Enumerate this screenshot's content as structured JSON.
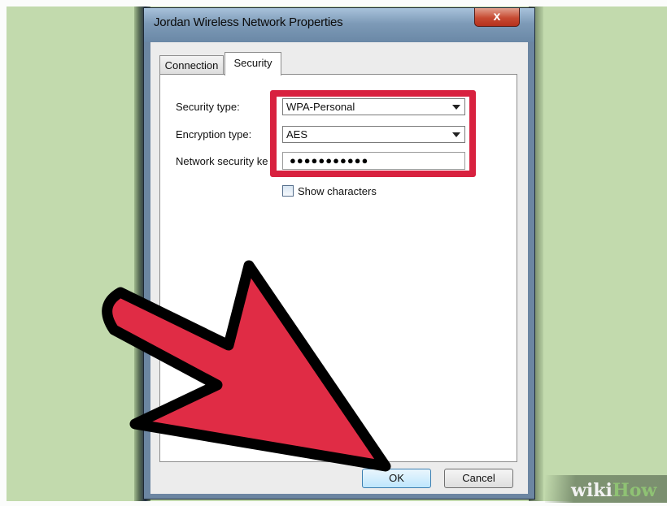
{
  "window": {
    "title": "Jordan Wireless Network Properties",
    "close_glyph": "x"
  },
  "tabs": [
    {
      "label": "Connection",
      "active": false
    },
    {
      "label": "Security",
      "active": true
    }
  ],
  "form": {
    "security_type": {
      "label": "Security type:",
      "value": "WPA-Personal"
    },
    "encryption_type": {
      "label": "Encryption type:",
      "value": "AES"
    },
    "network_key": {
      "label": "Network security ke",
      "value": "●●●●●●●●●●●"
    },
    "show_characters": {
      "label": "Show characters",
      "checked": false
    }
  },
  "buttons": {
    "ok": "OK",
    "cancel": "Cancel"
  },
  "annotations": {
    "highlight_color": "#d8213f",
    "arrow_color": "#e02c45",
    "arrow_points_to": "ok-button"
  },
  "watermark": {
    "part1": "wiki",
    "part2": "How"
  },
  "icons": [
    "close-icon",
    "chevron-down-icon",
    "checkbox-icon",
    "pointer-arrow-icon"
  ]
}
